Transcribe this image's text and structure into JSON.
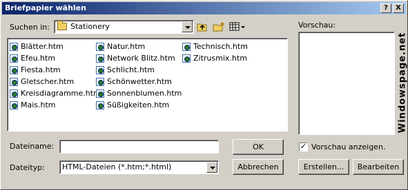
{
  "window": {
    "title": "Briefpapier wählen"
  },
  "titlebar": {
    "help_label": "?",
    "close_label": "X"
  },
  "lookin": {
    "label": "Suchen in:",
    "folder": "Stationery"
  },
  "files": {
    "col1": [
      "Blätter.htm",
      "Efeu.htm",
      "Fiesta.htm",
      "Gletscher.htm",
      "Kreisdiagramme.htm",
      "Mais.htm"
    ],
    "col2": [
      "Natur.htm",
      "Network Blitz.htm",
      "Schlicht.htm",
      "Schönwetter.htm",
      "Sonnenblumen.htm",
      "Süßigkeiten.htm"
    ],
    "col3": [
      "Technisch.htm",
      "Zitrusmix.htm"
    ]
  },
  "preview": {
    "label": "Vorschau:",
    "checkbox_label": "Vorschau anzeigen.",
    "checked": true
  },
  "filename": {
    "label": "Dateiname:",
    "value": ""
  },
  "filetype": {
    "label": "Dateityp:",
    "value": "HTML-Dateien (*.htm;*.html)"
  },
  "buttons": {
    "ok": "OK",
    "cancel": "Abbrechen",
    "create": "Erstellen...",
    "edit": "Bearbeiten"
  },
  "watermark": "Windowspage.net",
  "colors": {
    "titlebar_start": "#0a246a",
    "titlebar_end": "#a6caf0",
    "face": "#d4d0c8"
  }
}
